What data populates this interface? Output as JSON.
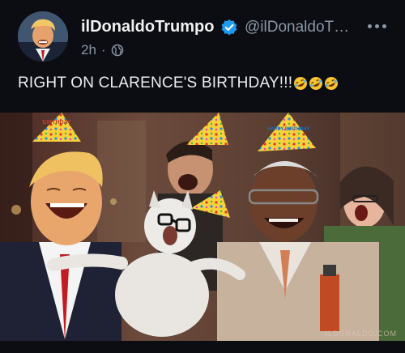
{
  "post": {
    "author": {
      "display_name": "ilDonaldoTrumpo",
      "handle": "@ilDonaldoT…",
      "verified": true,
      "avatar_icon": "avatar-photo"
    },
    "meta": {
      "time": "2h",
      "separator": "·",
      "visibility_icon": "globe-icon"
    },
    "text": "RIGHT ON CLARENCE'S BIRTHDAY!!!",
    "emoji_count": 3,
    "emoji_icon": "rolling-on-floor-laughing-emoji",
    "more_icon": "more-options-icon",
    "media": {
      "kind": "meme-image",
      "watermark": "ILDONALDO.COM",
      "hats": [
        "BIRTHDAY",
        "HAPPY BIRTHDAY"
      ]
    }
  },
  "colors": {
    "background": "#0b0d12",
    "text": "#e7e9ea",
    "muted": "#8b98a5",
    "verified": "#1d9bf0"
  }
}
